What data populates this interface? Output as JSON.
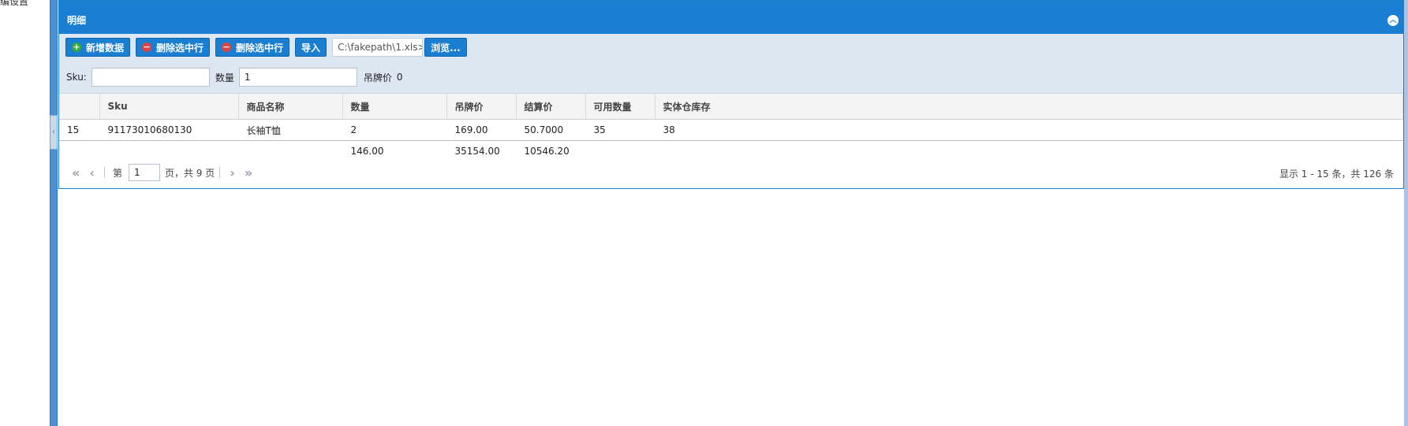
{
  "sidebar": {
    "partial_label": "编设置"
  },
  "panel": {
    "title": "明细"
  },
  "toolbar": {
    "add_label": "新增数据",
    "delete_label_1": "删除选中行",
    "delete_label_2": "删除选中行",
    "import_label": "导入",
    "file_value": "C:\\fakepath\\1.xls>",
    "browse_label": "浏览..."
  },
  "filter": {
    "sku_label": "Sku:",
    "sku_value": "",
    "qty_label": "数量",
    "qty_value": "1",
    "tag_price_label": "吊牌价",
    "tag_price_value": "0"
  },
  "grid": {
    "columns": [
      "",
      "Sku",
      "商品名称",
      "数量",
      "吊牌价",
      "结算价",
      "可用数量",
      "实体仓库存"
    ],
    "rows": [
      [
        "15",
        "91173010680130",
        "长袖T恤",
        "2",
        "169.00",
        "50.7000",
        "35",
        "38"
      ]
    ],
    "footer": [
      "",
      "",
      "",
      "146.00",
      "35154.00",
      "10546.20",
      "",
      ""
    ]
  },
  "pager": {
    "page_prefix": "第",
    "page_value": "1",
    "page_suffix": "页，共 9 页",
    "info": "显示 1 - 15 条，共 126 条"
  },
  "icons": {
    "first": "first-page-icon",
    "prev": "prev-page-icon",
    "next": "next-page-icon",
    "last": "last-page-icon",
    "collapse": "collapse-up-icon"
  },
  "colors": {
    "header_blue": "#1a7fd0",
    "toolbar_bg": "#dde7f1"
  }
}
